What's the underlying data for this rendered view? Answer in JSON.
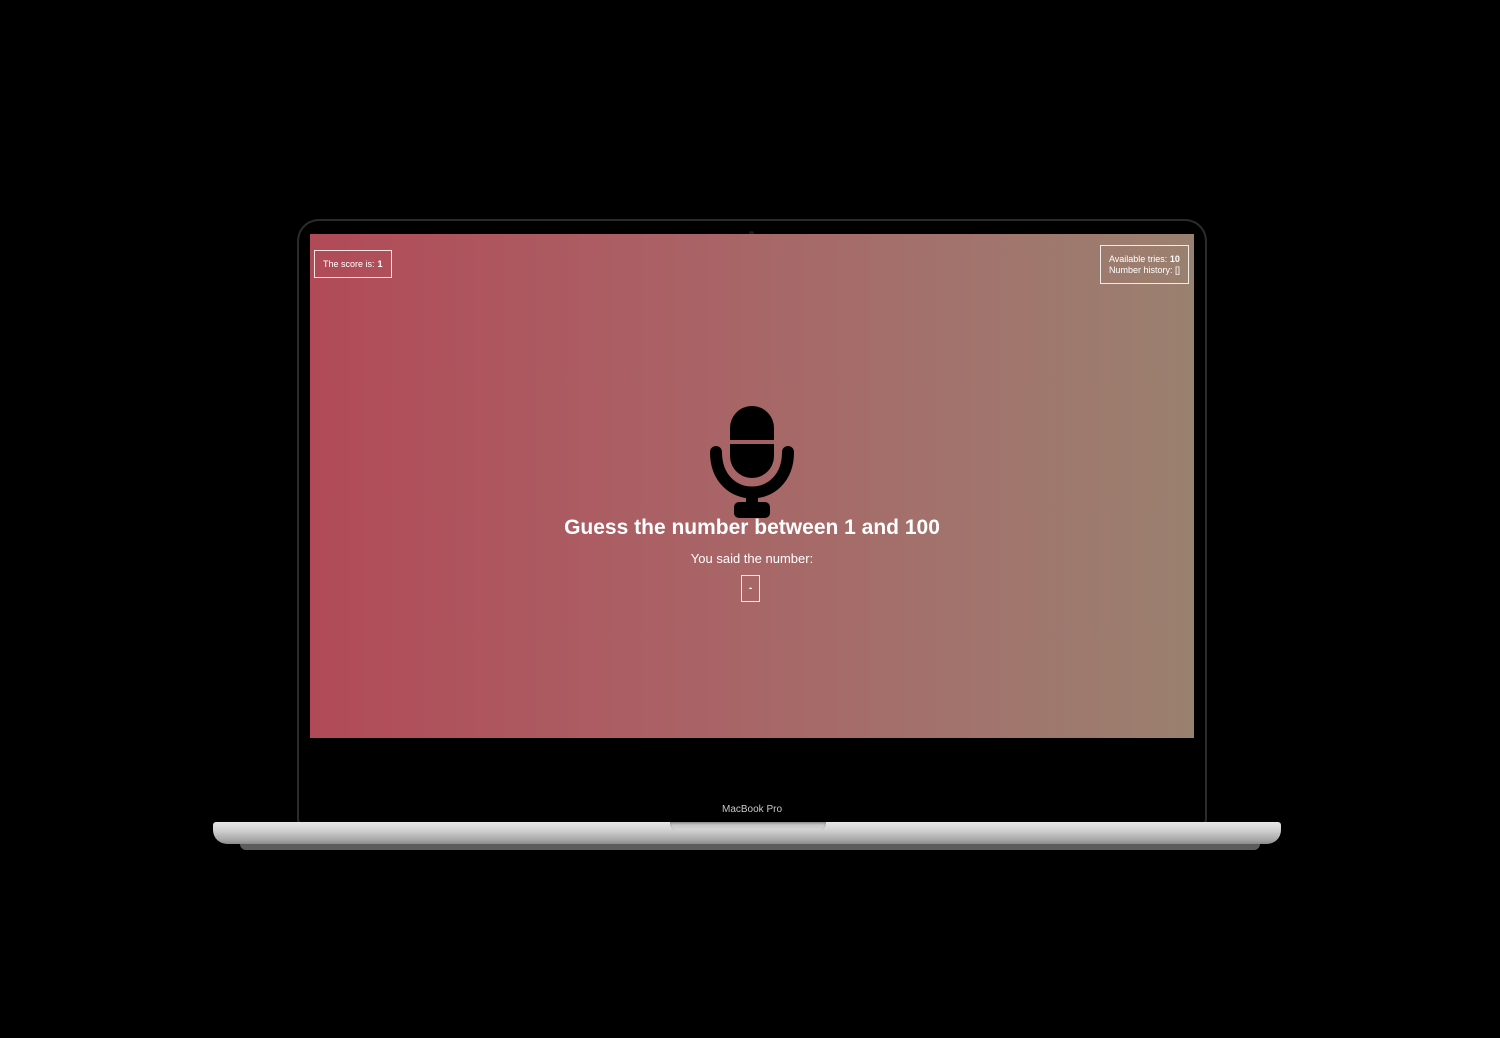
{
  "device": {
    "brand_label": "MacBook Pro"
  },
  "game": {
    "score_label": "The score is:",
    "score_value": "1",
    "tries_label": "Available tries:",
    "tries_value": "10",
    "history_label": "Number history:",
    "history_value": "[]",
    "title": "Guess the number between 1 and 100",
    "subtitle": "You said the number:",
    "said_number": "-"
  },
  "icons": {
    "mic": "microphone-icon"
  },
  "colors": {
    "gradient_start": "#b14a57",
    "gradient_end": "#9a806f",
    "text": "#ffffff",
    "icon": "#000000"
  }
}
